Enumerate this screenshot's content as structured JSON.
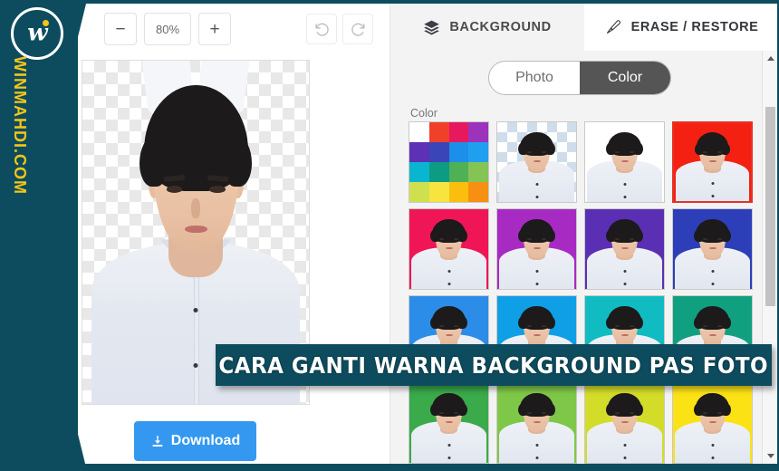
{
  "brand": {
    "logo_letter": "w",
    "site_text": "WINMAHDI.COM"
  },
  "banner": {
    "text": "CARA GANTI WARNA BACKGROUND PAS FOTO"
  },
  "editor": {
    "toolbar": {
      "zoom_out_label": "−",
      "zoom_level": "80%",
      "zoom_in_label": "+",
      "undo_icon": "undo-icon",
      "redo_icon": "redo-icon"
    },
    "canvas": {
      "background": "transparent-checkerboard",
      "subject": "portrait-photo"
    },
    "download_button": {
      "label": "Download",
      "icon": "download-icon",
      "color": "#3498f0"
    }
  },
  "side_panel": {
    "tabs": [
      {
        "label": "BACKGROUND",
        "icon": "layers-icon",
        "active": false
      },
      {
        "label": "ERASE / RESTORE",
        "icon": "brush-icon",
        "active": true
      }
    ],
    "mode_toggle": {
      "options": [
        {
          "label": "Photo",
          "active": false
        },
        {
          "label": "Color",
          "active": true
        }
      ]
    },
    "section_label": "Color",
    "palette_colors": [
      "#ffffff",
      "#f0402a",
      "#e6195f",
      "#9b33bd",
      "#5c31b5",
      "#3a46b8",
      "#1c8fe8",
      "#1fa0ef",
      "#0ab6cf",
      "#0d9b84",
      "#4fb055",
      "#84c455",
      "#cfe04f",
      "#f7e43f",
      "#fbbe0e",
      "#f79012"
    ],
    "swatches": [
      {
        "name": "color-picker",
        "type": "palette",
        "selected": false
      },
      {
        "name": "transparent",
        "type": "checker",
        "selected": false
      },
      {
        "name": "white",
        "type": "solid",
        "color": "#ffffff",
        "selected": false
      },
      {
        "name": "red",
        "type": "solid",
        "color": "#f42113",
        "selected": true
      },
      {
        "name": "pink",
        "type": "solid",
        "color": "#ef1556",
        "selected": false
      },
      {
        "name": "magenta",
        "type": "solid",
        "color": "#a72bc2",
        "selected": false
      },
      {
        "name": "purple",
        "type": "solid",
        "color": "#5b2fb4",
        "selected": false
      },
      {
        "name": "indigo",
        "type": "solid",
        "color": "#2c3fb8",
        "selected": false
      },
      {
        "name": "blue",
        "type": "solid",
        "color": "#2b8de8",
        "selected": false
      },
      {
        "name": "sky-blue",
        "type": "solid",
        "color": "#0e9fe6",
        "selected": false
      },
      {
        "name": "cyan",
        "type": "solid",
        "color": "#10bcc2",
        "selected": false
      },
      {
        "name": "teal",
        "type": "solid",
        "color": "#10a07f",
        "selected": false
      },
      {
        "name": "green",
        "type": "solid",
        "color": "#3aaa4a",
        "selected": false
      },
      {
        "name": "light-green",
        "type": "solid",
        "color": "#7fc748",
        "selected": false
      },
      {
        "name": "yellow-green",
        "type": "solid",
        "color": "#d3dc28",
        "selected": false
      },
      {
        "name": "yellow",
        "type": "solid",
        "color": "#fbe215",
        "selected": false
      }
    ],
    "scrollbar": {
      "up_arrow": "scroll-up-icon",
      "down_arrow": "scroll-down-icon"
    }
  }
}
